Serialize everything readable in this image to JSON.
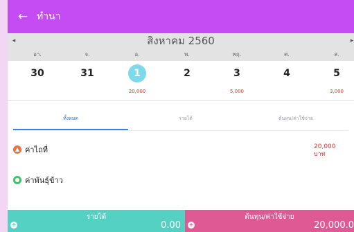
{
  "colors": {
    "appbar": "#c44cf2",
    "income": "#55d1c4",
    "cost": "#df5a95",
    "amount": "#e03030",
    "today": "#7ed9ec",
    "tab_active": "#3b82e0"
  },
  "appbar": {
    "back_icon": "arrow-left-icon",
    "back_glyph": "←",
    "title": "ทำนา"
  },
  "calendar": {
    "month_title": "สิงหาคม 2560",
    "prev_glyph": "◂",
    "next_glyph": "▸",
    "weekdays": [
      "อา.",
      "จ.",
      "อ.",
      "พ.",
      "พฤ.",
      "ศ.",
      "ส."
    ],
    "days": [
      {
        "num": "30",
        "amount": ""
      },
      {
        "num": "31",
        "amount": ""
      },
      {
        "num": "1",
        "amount": "20,000",
        "selected": true
      },
      {
        "num": "2",
        "amount": ""
      },
      {
        "num": "3",
        "amount": "5,000"
      },
      {
        "num": "4",
        "amount": ""
      },
      {
        "num": "5",
        "amount": "3,000"
      }
    ]
  },
  "tabs": [
    {
      "label": "ทั้งหมด",
      "active": true
    },
    {
      "label": "รายได้",
      "active": false
    },
    {
      "label": "ต้นทุน/ค่าใช้จ่าย",
      "active": false
    }
  ],
  "entries": [
    {
      "label": "ค่าไถที่",
      "amount_value": "20,000",
      "amount_unit": "บาท",
      "icon": "tractor-icon",
      "icon_color": "#e8704a"
    },
    {
      "label": "ค่าพันธุ์ข้าว",
      "amount_value": "",
      "amount_unit": "",
      "icon": "seed-icon",
      "icon_color": "#3cc46b"
    }
  ],
  "footer": {
    "income": {
      "label": "รายได้",
      "value": "0.00",
      "plus_glyph": "+"
    },
    "cost": {
      "label": "ต้นทุน/ค่าใช้จ่าย",
      "value": "20,000.0",
      "plus_glyph": "+"
    }
  }
}
